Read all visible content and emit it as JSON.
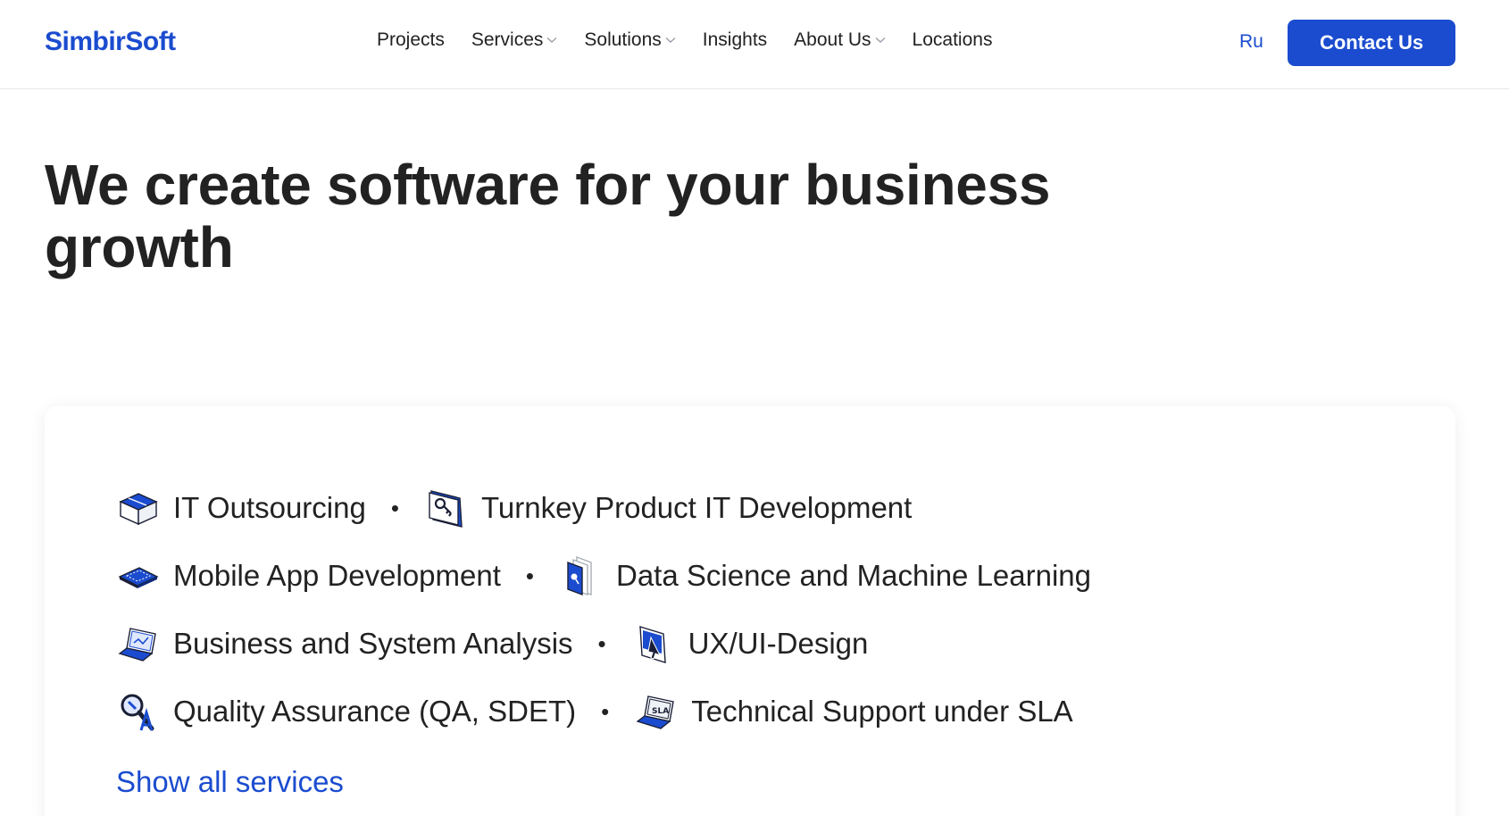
{
  "colors": {
    "brand_blue": "#1b4ccf",
    "text_dark": "#222222",
    "divider": "#e6e8ec"
  },
  "header": {
    "logo": "SimbirSoft",
    "nav": [
      {
        "label": "Projects",
        "dropdown": false
      },
      {
        "label": "Services",
        "dropdown": true
      },
      {
        "label": "Solutions",
        "dropdown": true
      },
      {
        "label": "Insights",
        "dropdown": false
      },
      {
        "label": "About Us",
        "dropdown": true
      },
      {
        "label": "Locations",
        "dropdown": false
      }
    ],
    "language": "Ru",
    "contact_label": "Contact Us"
  },
  "hero": {
    "title": "We create software for your business growth"
  },
  "services": {
    "rows": [
      [
        {
          "label": "IT Outsourcing",
          "icon": "box-icon"
        },
        {
          "label": "Turnkey Product IT Development",
          "icon": "key-icon"
        }
      ],
      [
        {
          "label": "Mobile App Development",
          "icon": "phone-icon"
        },
        {
          "label": "Data Science and Machine Learning",
          "icon": "data-layers-icon"
        }
      ],
      [
        {
          "label": "Business and System Analysis",
          "icon": "laptop-chart-icon"
        },
        {
          "label": "UX/UI-Design",
          "icon": "design-cursor-icon"
        }
      ],
      [
        {
          "label": "Quality Assurance (QA, SDET)",
          "icon": "magnifier-qa-icon"
        },
        {
          "label": "Technical Support under SLA",
          "icon": "laptop-sla-icon"
        }
      ]
    ],
    "show_all_label": "Show all services"
  }
}
